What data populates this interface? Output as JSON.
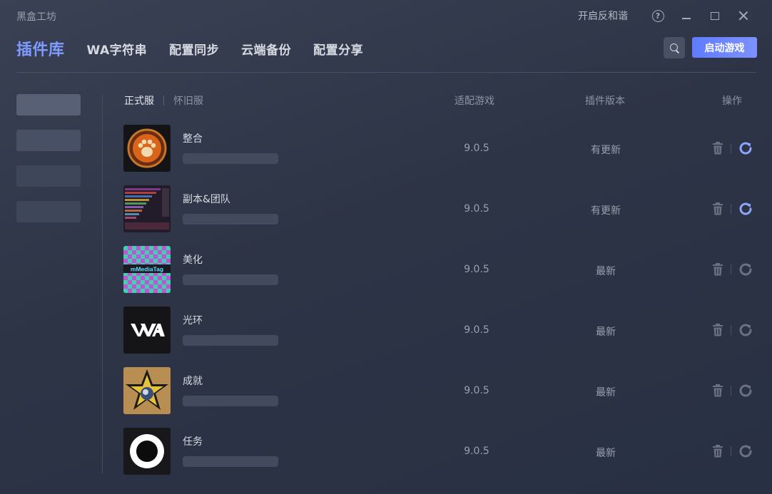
{
  "window": {
    "app_title": "黑盒工坊",
    "harmony_label": "开启反和谐",
    "help_glyph": "?"
  },
  "nav": {
    "tabs": [
      {
        "label": "插件库",
        "active": true
      },
      {
        "label": "WA字符串",
        "active": false
      },
      {
        "label": "配置同步",
        "active": false
      },
      {
        "label": "云端备份",
        "active": false
      },
      {
        "label": "配置分享",
        "active": false
      }
    ],
    "launch_label": "启动游戏"
  },
  "server_tabs": [
    {
      "label": "正式服",
      "active": true
    },
    {
      "label": "怀旧服",
      "active": false
    }
  ],
  "columns": {
    "game": "适配游戏",
    "version": "插件版本",
    "actions": "操作"
  },
  "plugins": [
    {
      "name": "整合",
      "game": "9.0.5",
      "version": "有更新",
      "has_update": true,
      "icon": "paw-emblem-icon"
    },
    {
      "name": "副本&团队",
      "game": "9.0.5",
      "version": "有更新",
      "has_update": true,
      "icon": "raid-meters-icon"
    },
    {
      "name": "美化",
      "game": "9.0.5",
      "version": "最新",
      "has_update": false,
      "icon": "checkerboard-icon",
      "icon_text": "mMediaTag"
    },
    {
      "name": "光环",
      "game": "9.0.5",
      "version": "最新",
      "has_update": false,
      "icon": "wa-logo-icon"
    },
    {
      "name": "成就",
      "game": "9.0.5",
      "version": "最新",
      "has_update": false,
      "icon": "star-badge-icon"
    },
    {
      "name": "任务",
      "game": "9.0.5",
      "version": "最新",
      "has_update": false,
      "icon": "ring-icon"
    }
  ],
  "colors": {
    "accent": "#7f9bff",
    "launch_gradient_start": "#5f7bff",
    "update_icon": "#8fa6ff",
    "idle_icon": "#6b7182"
  }
}
